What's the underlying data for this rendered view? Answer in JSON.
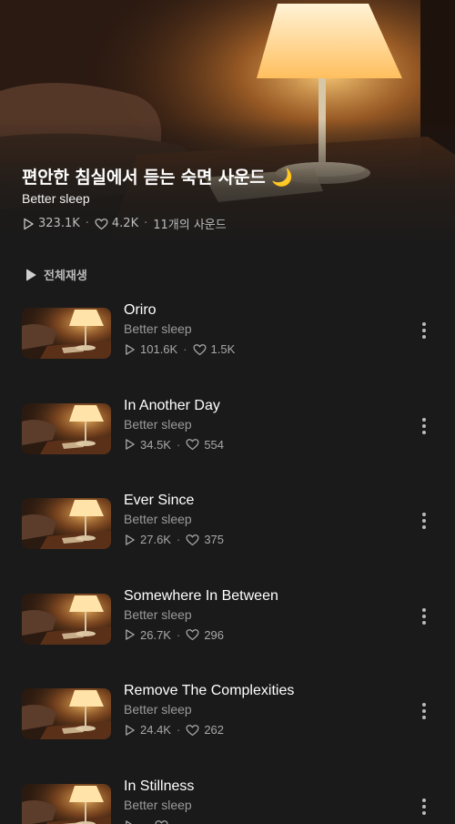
{
  "playlist": {
    "title": "편안한 침실에서 듣는 숙면 사운드 🌙",
    "artist": "Better sleep",
    "plays": "323.1K",
    "likes": "4.2K",
    "count": "11개의 사운드"
  },
  "play_all_label": "전체재생",
  "icons": {
    "play": "play-outline-icon",
    "heart": "heart-outline-icon",
    "more": "more-vertical-icon",
    "play_all": "play-filled-icon"
  },
  "colors": {
    "background": "#1a1a1a",
    "muted_text": "#9a9a9a",
    "lamp_glow": "#ffcc77"
  },
  "tracks": [
    {
      "title": "Oriro",
      "artist": "Better sleep",
      "plays": "101.6K",
      "likes": "1.5K"
    },
    {
      "title": "In Another Day",
      "artist": "Better sleep",
      "plays": "34.5K",
      "likes": "554"
    },
    {
      "title": "Ever Since",
      "artist": "Better sleep",
      "plays": "27.6K",
      "likes": "375"
    },
    {
      "title": "Somewhere In Between",
      "artist": "Better sleep",
      "plays": "26.7K",
      "likes": "296"
    },
    {
      "title": "Remove The Complexities",
      "artist": "Better sleep",
      "plays": "24.4K",
      "likes": "262"
    },
    {
      "title": "In Stillness",
      "artist": "Better sleep",
      "plays": "",
      "likes": ""
    }
  ]
}
